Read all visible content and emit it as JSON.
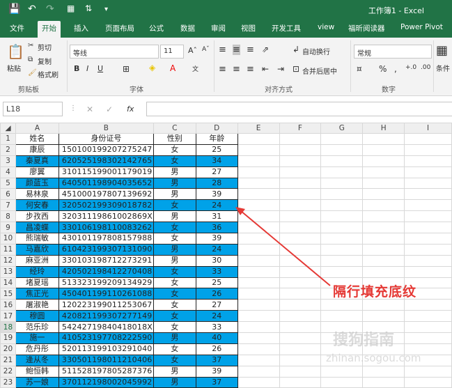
{
  "window": {
    "title": "工作簿1  -  Excel"
  },
  "menu_tabs": [
    "文件",
    "开始",
    "插入",
    "页面布局",
    "公式",
    "数据",
    "审阅",
    "视图",
    "开发工具",
    "view",
    "福昕阅读器",
    "Power Pivot"
  ],
  "active_tab": "开始",
  "ribbon": {
    "paste": "粘贴",
    "cut": "剪切",
    "copy": "复制",
    "format_painter": "格式刷",
    "clipboard_group": "剪贴板",
    "font_name": "等线",
    "font_size": "11",
    "font_group": "字体",
    "wrap_text": "自动换行",
    "merge_center": "合并后居中",
    "align_group": "对齐方式",
    "number_format": "常规",
    "number_group": "数字",
    "conditional": "条件"
  },
  "formula_bar": {
    "name_box": "L18",
    "formula": ""
  },
  "columns": [
    "A",
    "B",
    "C",
    "D",
    "E",
    "F",
    "G",
    "H",
    "I"
  ],
  "header_row": [
    "姓名",
    "身份证号",
    "性别",
    "年龄"
  ],
  "rows": [
    {
      "n": "2",
      "name": "康辰",
      "id": "150100199207275247",
      "sex": "女",
      "age": "25",
      "blue": false
    },
    {
      "n": "3",
      "name": "秦夏真",
      "id": "620525198302142765",
      "sex": "女",
      "age": "34",
      "blue": true
    },
    {
      "n": "4",
      "name": "廖翼",
      "id": "310115199001179019",
      "sex": "男",
      "age": "27",
      "blue": false
    },
    {
      "n": "5",
      "name": "颜蓝玉",
      "id": "640501198904035652",
      "sex": "男",
      "age": "28",
      "blue": true
    },
    {
      "n": "6",
      "name": "易林泉",
      "id": "451000197807139692",
      "sex": "男",
      "age": "39",
      "blue": false
    },
    {
      "n": "7",
      "name": "何安春",
      "id": "320502199309018782",
      "sex": "女",
      "age": "24",
      "blue": true
    },
    {
      "n": "8",
      "name": "步孜西",
      "id": "32031119861002869X",
      "sex": "男",
      "age": "31",
      "blue": false
    },
    {
      "n": "9",
      "name": "昌凌蝶",
      "id": "330106198110083262",
      "sex": "女",
      "age": "36",
      "blue": true
    },
    {
      "n": "10",
      "name": "熊瑞敏",
      "id": "430101197808157988",
      "sex": "女",
      "age": "39",
      "blue": false
    },
    {
      "n": "11",
      "name": "马嘉欣",
      "id": "610423199307131090",
      "sex": "男",
      "age": "24",
      "blue": true
    },
    {
      "n": "12",
      "name": "麻亚洲",
      "id": "330103198712273291",
      "sex": "男",
      "age": "30",
      "blue": false
    },
    {
      "n": "13",
      "name": "经玲",
      "id": "420502198412270408",
      "sex": "女",
      "age": "33",
      "blue": true
    },
    {
      "n": "14",
      "name": "堵夏瑶",
      "id": "513323199209134929",
      "sex": "女",
      "age": "25",
      "blue": false
    },
    {
      "n": "15",
      "name": "焦正光",
      "id": "450401199110261088",
      "sex": "女",
      "age": "26",
      "blue": true
    },
    {
      "n": "16",
      "name": "屠淑艳",
      "id": "120223199011253067",
      "sex": "女",
      "age": "27",
      "blue": false
    },
    {
      "n": "17",
      "name": "穆圆",
      "id": "420821199307277149",
      "sex": "女",
      "age": "24",
      "blue": true
    },
    {
      "n": "18",
      "name": "范乐珍",
      "id": "54242719840418018X",
      "sex": "女",
      "age": "33",
      "blue": false
    },
    {
      "n": "19",
      "name": "施一",
      "id": "410523197708222590",
      "sex": "男",
      "age": "40",
      "blue": true
    },
    {
      "n": "20",
      "name": "危丹彤",
      "id": "520113199103291040",
      "sex": "女",
      "age": "26",
      "blue": false
    },
    {
      "n": "21",
      "name": "逄从冬",
      "id": "330501198011210406",
      "sex": "女",
      "age": "37",
      "blue": true
    },
    {
      "n": "22",
      "name": "鲍恒韩",
      "id": "511528197805287376",
      "sex": "男",
      "age": "39",
      "blue": false
    },
    {
      "n": "23",
      "name": "苏一娘",
      "id": "370112198002045992",
      "sex": "男",
      "age": "37",
      "blue": true
    }
  ],
  "annotation": "隔行填充底纹",
  "watermark": "搜狗指南",
  "watermark_url": "zhinan.sogou.com",
  "colors": {
    "excel_green": "#217346",
    "fill_blue": "#00a2e8",
    "annotation_red": "#e53935"
  }
}
